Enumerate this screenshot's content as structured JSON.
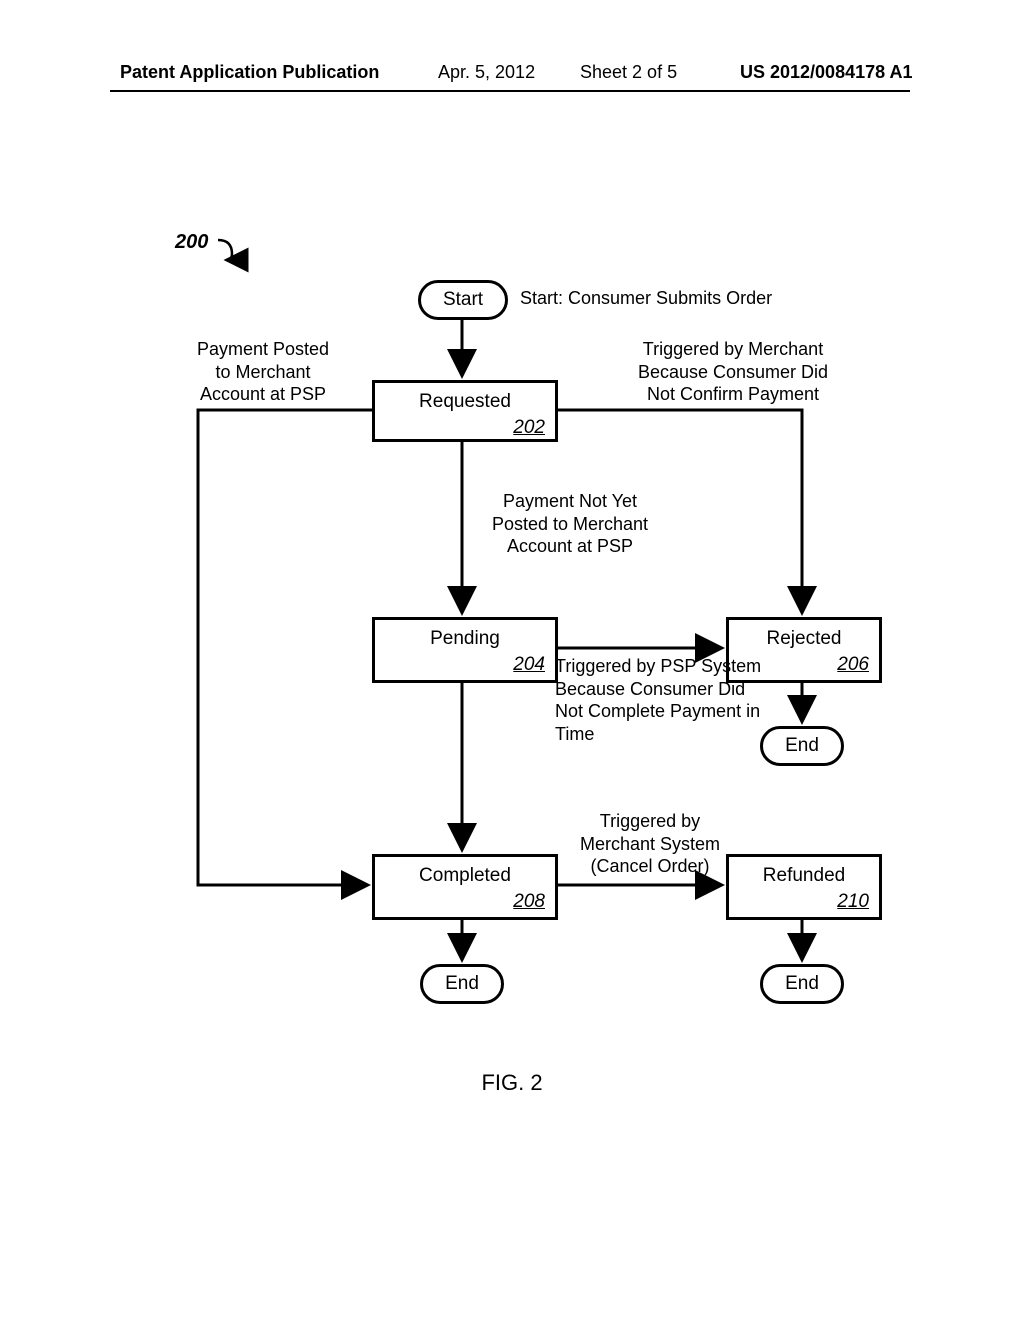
{
  "header": {
    "left": "Patent Application Publication",
    "date": "Apr. 5, 2012",
    "sheet": "Sheet 2 of 5",
    "pubno": "US 2012/0084178 A1"
  },
  "diagram": {
    "ref": "200",
    "start": {
      "label": "Start",
      "caption": "Start: Consumer Submits Order"
    },
    "states": {
      "requested": {
        "label": "Requested",
        "ref": "202"
      },
      "pending": {
        "label": "Pending",
        "ref": "204"
      },
      "rejected": {
        "label": "Rejected",
        "ref": "206"
      },
      "completed": {
        "label": "Completed",
        "ref": "208"
      },
      "refunded": {
        "label": "Refunded",
        "ref": "210"
      }
    },
    "end": {
      "label": "End"
    },
    "annotations": {
      "posted": "Payment Posted\nto Merchant\nAccount at PSP",
      "merchant_trigger": "Triggered by Merchant\nBecause Consumer Did\nNot Confirm Payment",
      "notposted": "Payment Not Yet\nPosted to Merchant\nAccount at PSP",
      "psp_trigger": "Triggered by PSP System\nBecause Consumer Did\nNot Complete Payment in\nTime",
      "cancel": "Triggered by\nMerchant System\n(Cancel Order)"
    },
    "figure": "FIG. 2"
  }
}
